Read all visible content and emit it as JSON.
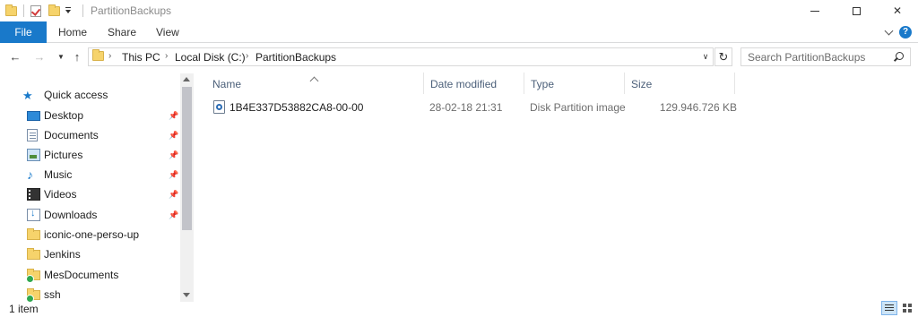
{
  "window": {
    "title": "PartitionBackups",
    "minimize_glyph": "",
    "maximize_glyph": "",
    "close_glyph": "✕"
  },
  "ribbon": {
    "tabs": [
      {
        "label": "File",
        "active": true
      },
      {
        "label": "Home"
      },
      {
        "label": "Share"
      },
      {
        "label": "View"
      }
    ],
    "help_glyph": "?"
  },
  "navigation": {
    "back_glyph": "←",
    "forward_glyph": "→",
    "recent_glyph": "▼",
    "up_glyph": "↑",
    "breadcrumb": [
      "This PC",
      "Local Disk (C:)",
      "PartitionBackups"
    ],
    "crumb_separator": "›",
    "dropdown_glyph": "∨",
    "refresh_glyph": "↻"
  },
  "search": {
    "placeholder": "Search PartitionBackups"
  },
  "nav_pane": {
    "quick_access_label": "Quick access",
    "items": [
      {
        "label": "Desktop",
        "icon": "desktop-icon",
        "pinned": true
      },
      {
        "label": "Documents",
        "icon": "documents-icon",
        "pinned": true
      },
      {
        "label": "Pictures",
        "icon": "pictures-icon",
        "pinned": true
      },
      {
        "label": "Music",
        "icon": "music-icon",
        "pinned": true
      },
      {
        "label": "Videos",
        "icon": "videos-icon",
        "pinned": true
      },
      {
        "label": "Downloads",
        "icon": "downloads-icon",
        "pinned": true
      },
      {
        "label": "iconic-one-perso-up",
        "icon": "folder-icon",
        "pinned": false
      },
      {
        "label": "Jenkins",
        "icon": "folder-icon",
        "pinned": false
      },
      {
        "label": "MesDocuments",
        "icon": "folder-icon",
        "pinned": false,
        "synced": true
      },
      {
        "label": "ssh",
        "icon": "folder-icon",
        "pinned": false,
        "synced": true
      }
    ],
    "pin_glyph": "📌",
    "music_glyph": "♪"
  },
  "file_list": {
    "columns": {
      "name": "Name",
      "date_modified": "Date modified",
      "type": "Type",
      "size": "Size"
    },
    "sorted_by": "Name",
    "rows": [
      {
        "name": "1B4E337D53882CA8-00-00",
        "date_modified": "28-02-18 21:31",
        "type": "Disk Partition image",
        "size": "129.946.726 KB",
        "icon": "disk-image-icon"
      }
    ]
  },
  "status_bar": {
    "item_count": "1 item"
  },
  "colors": {
    "accent": "#1979ca",
    "folder": "#f6d36b",
    "header_text": "#4c607a"
  }
}
